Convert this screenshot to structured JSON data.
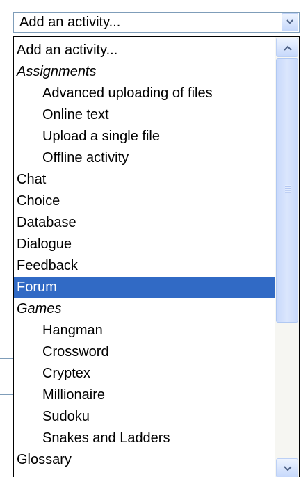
{
  "select": {
    "value": "Add an activity..."
  },
  "dropdown": {
    "items": [
      {
        "label": "Add an activity...",
        "kind": "option"
      },
      {
        "label": "Assignments",
        "kind": "group"
      },
      {
        "label": "Advanced uploading of files",
        "kind": "child"
      },
      {
        "label": "Online text",
        "kind": "child"
      },
      {
        "label": "Upload a single file",
        "kind": "child"
      },
      {
        "label": "Offline activity",
        "kind": "child"
      },
      {
        "label": "Chat",
        "kind": "option"
      },
      {
        "label": "Choice",
        "kind": "option"
      },
      {
        "label": "Database",
        "kind": "option"
      },
      {
        "label": "Dialogue",
        "kind": "option"
      },
      {
        "label": "Feedback",
        "kind": "option"
      },
      {
        "label": "Forum",
        "kind": "option",
        "selected": true
      },
      {
        "label": "Games",
        "kind": "group"
      },
      {
        "label": "Hangman",
        "kind": "child"
      },
      {
        "label": "Crossword",
        "kind": "child"
      },
      {
        "label": "Cryptex",
        "kind": "child"
      },
      {
        "label": "Millionaire",
        "kind": "child"
      },
      {
        "label": "Sudoku",
        "kind": "child"
      },
      {
        "label": "Snakes and Ladders",
        "kind": "child"
      },
      {
        "label": "Glossary",
        "kind": "option"
      }
    ]
  },
  "icons": {
    "select_arrow": "chevron-down-icon",
    "scroll_up": "scroll-up-arrow-icon",
    "scroll_down": "scroll-down-arrow-icon",
    "thumb_grip": "grip-icon"
  },
  "colors": {
    "selection_bg": "#316ac5",
    "selection_fg": "#ffffff",
    "arrow": "#4d6185"
  }
}
